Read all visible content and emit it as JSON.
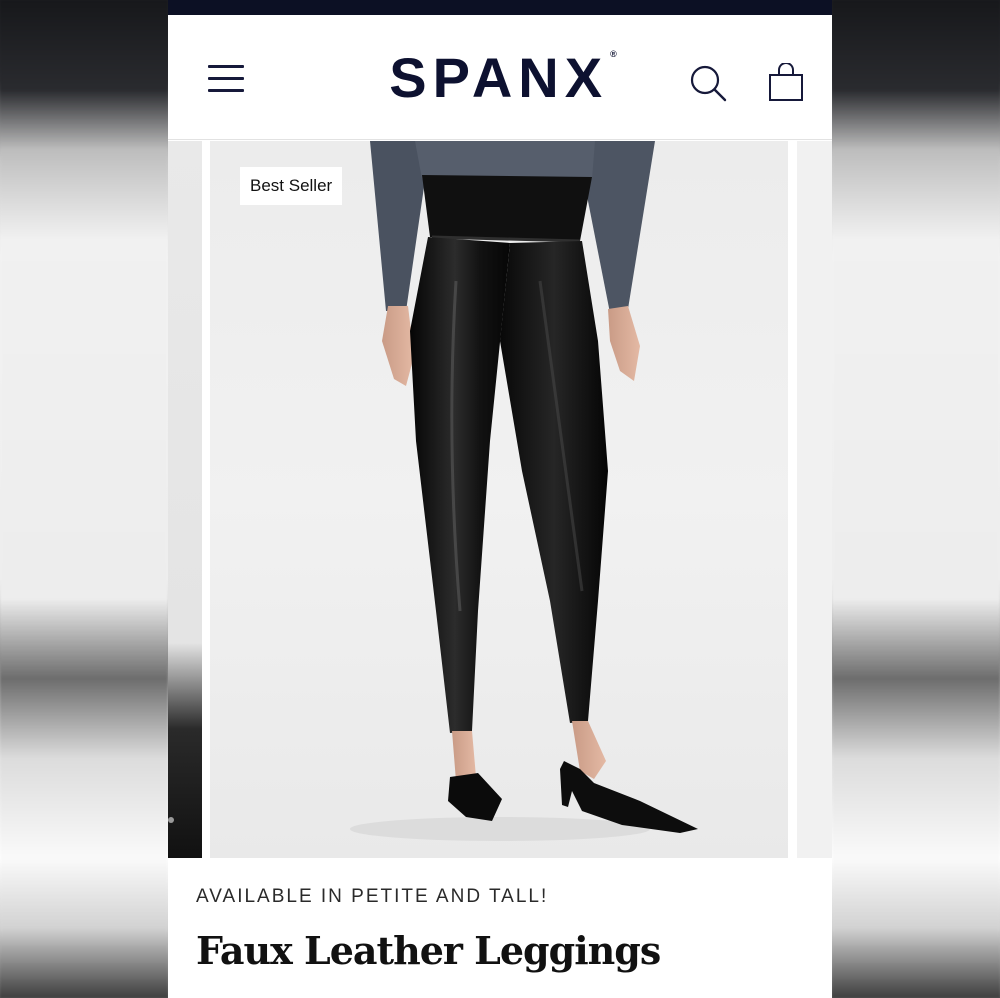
{
  "header": {
    "brand": "SPANX",
    "brand_mark": "®",
    "icons": {
      "menu": "menu-icon",
      "search": "search-icon",
      "cart": "shopping-bag-icon"
    }
  },
  "product": {
    "badge": "Best Seller",
    "promo": "AVAILABLE IN PETITE AND TALL!",
    "title": "Faux Leather Leggings"
  },
  "colors": {
    "brand_navy": "#0d1130",
    "top_strip": "#0c1024",
    "photo_background": "#ececec",
    "leggings": "#111111",
    "top": "#4a5260"
  }
}
